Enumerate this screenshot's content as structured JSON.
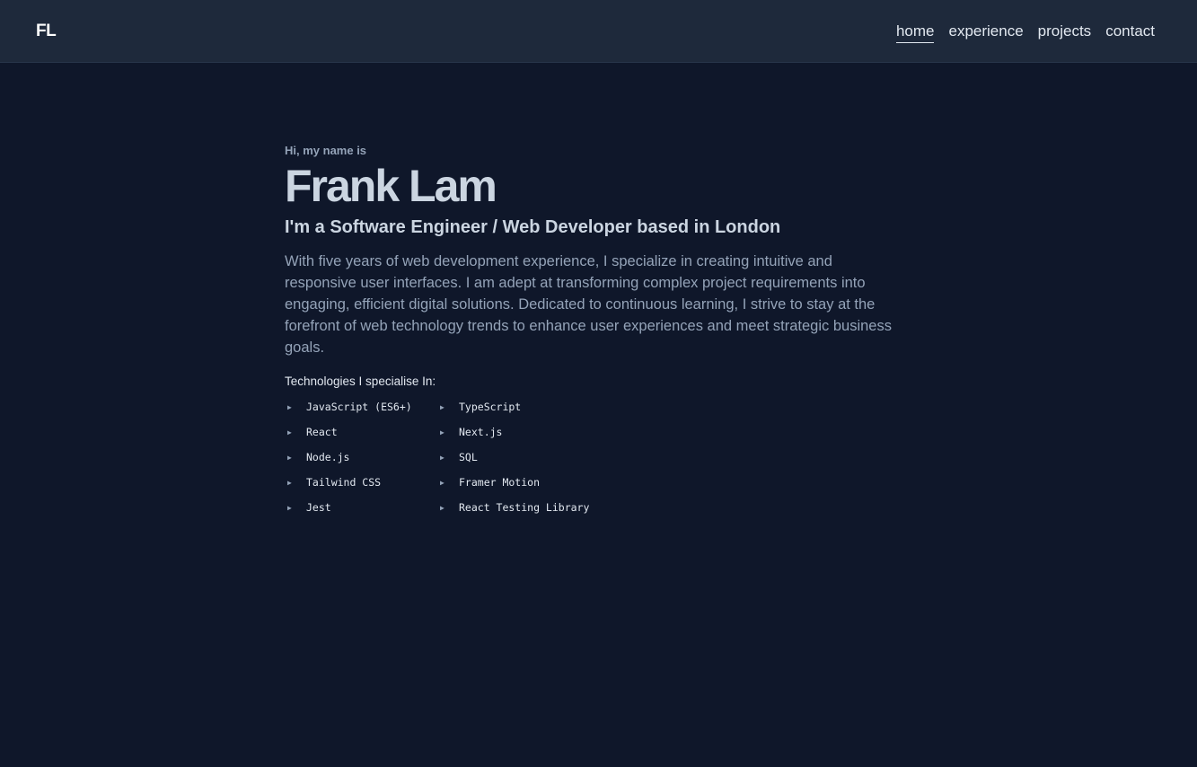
{
  "header": {
    "logo": "FL",
    "nav": [
      {
        "label": "home",
        "active": true
      },
      {
        "label": "experience",
        "active": false
      },
      {
        "label": "projects",
        "active": false
      },
      {
        "label": "contact",
        "active": false
      }
    ]
  },
  "hero": {
    "greeting": "Hi, my name is",
    "name": "Frank Lam",
    "tagline": "I'm a Software Engineer / Web Developer based in London",
    "bio": "With five years of web development experience, I specialize in creating intuitive and responsive user interfaces. I am adept at transforming complex project requirements into engaging, efficient digital solutions. Dedicated to continuous learning, I strive to stay at the forefront of web technology trends to enhance user experiences and meet strategic business goals.",
    "tech_heading": "Technologies I specialise In:",
    "technologies": [
      "JavaScript (ES6+)",
      "TypeScript",
      "React",
      "Next.js",
      "Node.js",
      "SQL",
      "Tailwind CSS",
      "Framer Motion",
      "Jest",
      "React Testing Library"
    ],
    "bullet_icon": "triangle-right-icon"
  },
  "colors": {
    "background": "#0f172a",
    "header": "#1e293b",
    "text_primary": "#cbd5e1",
    "text_muted": "#94a3b8"
  }
}
